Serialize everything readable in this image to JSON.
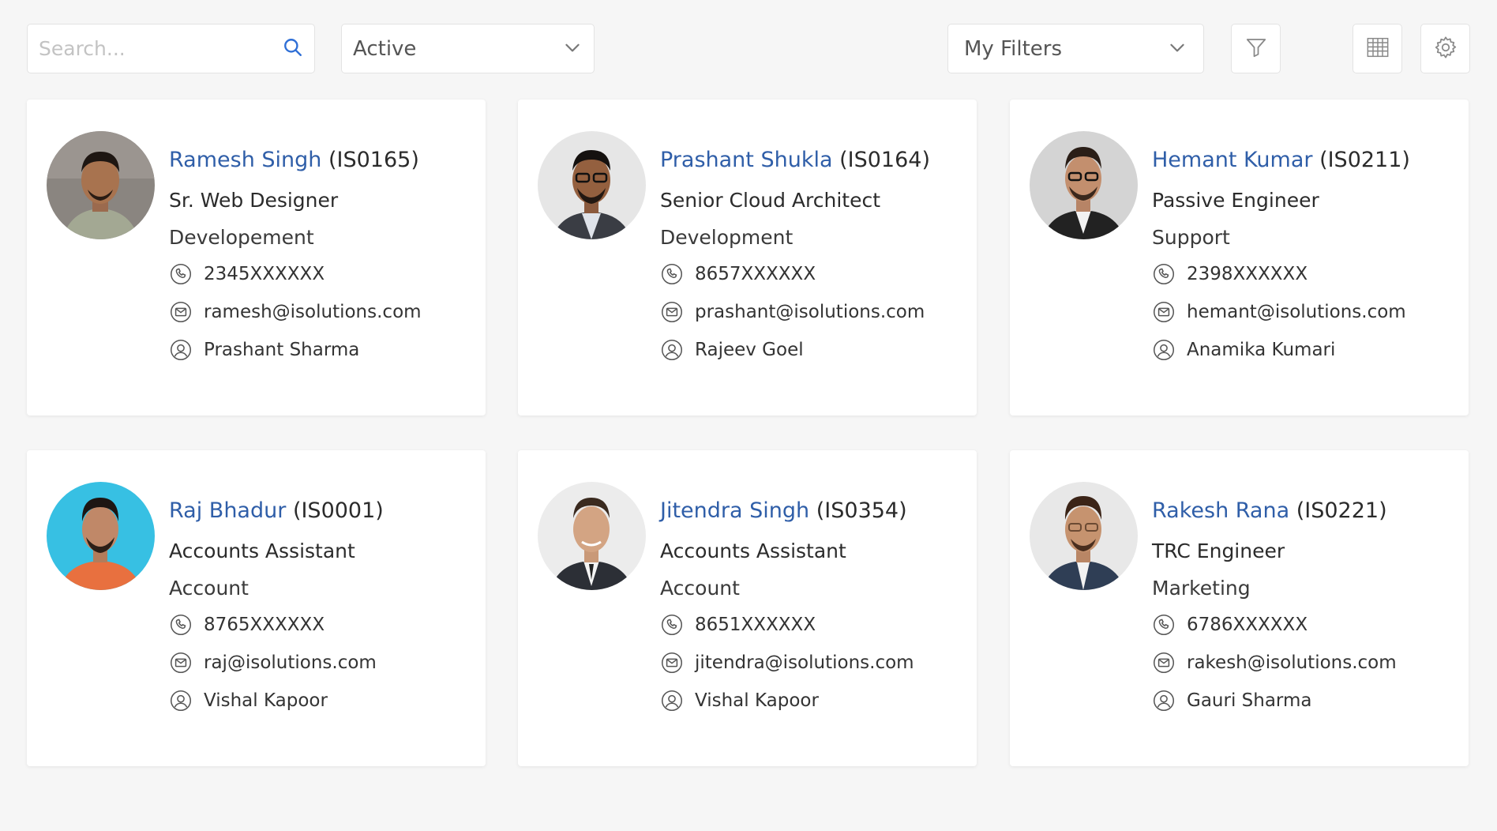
{
  "toolbar": {
    "search_placeholder": "Search...",
    "status_value": "Active",
    "filters_value": "My Filters",
    "icons": [
      "search-icon",
      "chevron-down-icon",
      "filter-icon",
      "grid-icon",
      "gear-icon"
    ]
  },
  "colors": {
    "name_blue": "#2f5ea8",
    "search_icon_blue": "#2f6fd6",
    "background": "#f6f6f6"
  },
  "cards": [
    {
      "name": "Ramesh Singh",
      "code": "(IS0165)",
      "title": "Sr. Web Designer",
      "department": "Developement",
      "phone": "2345XXXXXX",
      "email": "ramesh@isolutions.com",
      "manager": "Prashant Sharma"
    },
    {
      "name": "Prashant Shukla",
      "code": "(IS0164)",
      "title": "Senior Cloud Architect",
      "department": "Development",
      "phone": "8657XXXXXX",
      "email": "prashant@isolutions.com",
      "manager": "Rajeev Goel"
    },
    {
      "name": "Hemant Kumar",
      "code": "(IS0211)",
      "title": "Passive Engineer",
      "department": "Support",
      "phone": "2398XXXXXX",
      "email": "hemant@isolutions.com",
      "manager": "Anamika Kumari"
    },
    {
      "name": "Raj Bhadur",
      "code": "(IS0001)",
      "title": "Accounts Assistant",
      "department": "Account",
      "phone": "8765XXXXXX",
      "email": "raj@isolutions.com",
      "manager": "Vishal Kapoor"
    },
    {
      "name": "Jitendra Singh",
      "code": "(IS0354)",
      "title": "Accounts Assistant",
      "department": "Account",
      "phone": "8651XXXXXX",
      "email": "jitendra@isolutions.com",
      "manager": "Vishal Kapoor"
    },
    {
      "name": "Rakesh Rana",
      "code": "(IS0221)",
      "title": "TRC Engineer",
      "department": "Marketing",
      "phone": "6786XXXXXX",
      "email": "rakesh@isolutions.com",
      "manager": "Gauri Sharma"
    }
  ]
}
